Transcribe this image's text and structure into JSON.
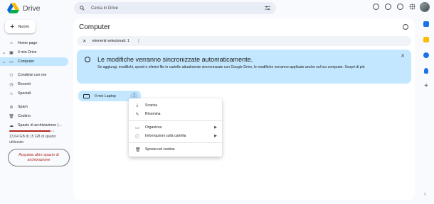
{
  "app": {
    "name": "Drive"
  },
  "search": {
    "placeholder": "Cerca in Drive"
  },
  "sidebar": {
    "new_label": "Nuovo",
    "items": [
      {
        "label": "Home page",
        "icon": "home-icon"
      },
      {
        "label": "Il mio Drive",
        "icon": "my-drive-icon"
      },
      {
        "label": "Computer",
        "icon": "computer-icon",
        "active": true
      },
      {
        "label": "Condivisi con me",
        "icon": "shared-icon"
      },
      {
        "label": "Recenti",
        "icon": "clock-icon"
      },
      {
        "label": "Speciali",
        "icon": "star-icon"
      },
      {
        "label": "Spam",
        "icon": "spam-icon"
      },
      {
        "label": "Cestino",
        "icon": "trash-icon"
      },
      {
        "label": "Spazio di archiviazione (...",
        "icon": "cloud-icon"
      }
    ],
    "storage": {
      "text": "13,64 GB di 15 GB di spazio utilizzato",
      "fraction": 0.909
    },
    "buy_label": "Acquista altro spazio di archiviazione"
  },
  "main": {
    "title": "Computer",
    "selection_text": "elementi selezionati: 1",
    "banner": {
      "title": "Le modifiche verranno sincronizzate automaticamente.",
      "body": "Se aggiungi, modifichi, sposti o elimini file in cartelle attualmente sincronizzate con Google Drive, le modifiche verranno applicate anche sul tuo computer. Scopri di più"
    },
    "device": {
      "name": "Il mio Laptop"
    }
  },
  "context_menu": [
    {
      "label": "Scarica",
      "icon": "download-icon"
    },
    {
      "label": "Rinomina",
      "icon": "rename-icon"
    },
    {
      "label": "Organizza",
      "icon": "folder-icon",
      "submenu": true
    },
    {
      "label": "Informazioni sulla cartella",
      "icon": "info-icon",
      "submenu": true
    },
    {
      "label": "Sposta nel cestino",
      "icon": "trash-icon"
    }
  ],
  "colors": {
    "accent": "#c2e7ff",
    "storage_warning": "#b3261e"
  }
}
